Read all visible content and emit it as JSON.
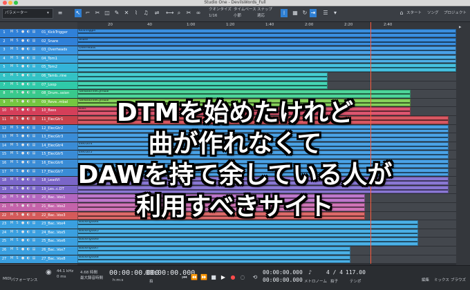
{
  "window": {
    "title": "Studio One - DevilsWords_Full"
  },
  "toolbar": {
    "param_label": "パラメーター",
    "quantize_label": "クオンタイズ",
    "quantize_value": "1/16",
    "timebase_label": "タイムベース",
    "timebase_value": "小節",
    "snap_label": "スナップ",
    "snap_value": "適応",
    "start_label": "スタート",
    "song_label": "ソング",
    "project_label": "プロジェクト"
  },
  "ruler": {
    "ticks": [
      "20",
      "40",
      "1:00",
      "1:20",
      "1:40",
      "2:00",
      "2:20",
      "2:40"
    ]
  },
  "tracks": [
    {
      "num": "1",
      "name": "01_KickTrigger",
      "color": "#2f80d8"
    },
    {
      "num": "2",
      "name": "02_Snare",
      "color": "#2f80d8"
    },
    {
      "num": "3",
      "name": "03_Overheads",
      "color": "#3a94e0"
    },
    {
      "num": "4",
      "name": "04_Tom1",
      "color": "#3aa5df"
    },
    {
      "num": "5",
      "name": "05_Tom2",
      "color": "#34b4d8"
    },
    {
      "num": "6",
      "name": "06_Tamb..rine",
      "color": "#33c2c4"
    },
    {
      "num": "7",
      "name": "07_Loop",
      "color": "#2fcaa9"
    },
    {
      "num": "8",
      "name": "08_Drum..ssion",
      "color": "#39c98c"
    },
    {
      "num": "9",
      "name": "09_Reve..mbal",
      "color": "#74c640"
    },
    {
      "num": "10",
      "name": "10_Bass",
      "color": "#d43f59"
    },
    {
      "num": "11",
      "name": "11_ElecGtr1",
      "color": "#c8414a"
    },
    {
      "num": "12",
      "name": "12_ElecGtr2",
      "color": "#3a8cd6"
    },
    {
      "num": "13",
      "name": "13_ElecGtr3",
      "color": "#3a8cd6"
    },
    {
      "num": "14",
      "name": "14_ElecGtr4",
      "color": "#3a8cd6"
    },
    {
      "num": "15",
      "name": "15_ElecGtr5",
      "color": "#3a8cd6"
    },
    {
      "num": "16",
      "name": "16_ElecGtr6",
      "color": "#3a8cd6"
    },
    {
      "num": "17",
      "name": "17_ElecGtr7",
      "color": "#3a8cd6"
    },
    {
      "num": "18",
      "name": "18_LeadVl",
      "color": "#7a66c8"
    },
    {
      "num": "19",
      "name": "19_Les..c.DT",
      "color": "#7a66c8"
    },
    {
      "num": "20",
      "name": "20_Bac..Vox1",
      "color": "#b266c0"
    },
    {
      "num": "21",
      "name": "21_Bac..Vox2",
      "color": "#c463aa"
    },
    {
      "num": "22",
      "name": "22_Bac..Vox3",
      "color": "#d45a5a"
    },
    {
      "num": "23",
      "name": "23_Bac..Vox4",
      "color": "#3a9fe0"
    },
    {
      "num": "24",
      "name": "24_Bac..Vox5",
      "color": "#3a9fe0"
    },
    {
      "num": "25",
      "name": "25_Bac..Vox6",
      "color": "#3a9fe0"
    },
    {
      "num": "26",
      "name": "26_Bac..Vox7",
      "color": "#3a9fe0"
    },
    {
      "num": "27",
      "name": "27_Bac..Vox8",
      "color": "#3a9fe0"
    }
  ],
  "clips": [
    {
      "lane": 0,
      "label": "KickTrigger",
      "color": "#3a8fe0",
      "start": 0.0,
      "end": 1.0
    },
    {
      "lane": 1,
      "label": "Snare",
      "color": "#3a8fe0",
      "start": 0.0,
      "end": 1.0
    },
    {
      "lane": 2,
      "label": "Overheads",
      "color": "#4aa0e6",
      "start": 0.0,
      "end": 1.0
    },
    {
      "lane": 3,
      "label": "",
      "color": "#4fb0e6",
      "start": 0.0,
      "end": 1.0
    },
    {
      "lane": 4,
      "label": "",
      "color": "#46c0df",
      "start": 0.0,
      "end": 1.0
    },
    {
      "lane": 5,
      "label": "",
      "color": "#46cdd0",
      "start": 0.0,
      "end": 0.66
    },
    {
      "lane": 6,
      "label": "",
      "color": "#46d6b5",
      "start": 0.0,
      "end": 0.66
    },
    {
      "lane": 7,
      "label": "TambourineCymbal",
      "color": "#4ed59a",
      "start": 0.0,
      "end": 0.88
    },
    {
      "lane": 8,
      "label": "TambourineCymbal",
      "color": "#86d25a",
      "start": 0.0,
      "end": 0.88
    },
    {
      "lane": 9,
      "label": "Bass",
      "color": "#de5670",
      "start": 0.0,
      "end": 0.88
    },
    {
      "lane": 10,
      "label": "",
      "color": "#d85862",
      "start": 0.0,
      "end": 0.98
    },
    {
      "lane": 11,
      "label": "",
      "color": "#4aa2e6",
      "start": 0.0,
      "end": 0.98
    },
    {
      "lane": 12,
      "label": "",
      "color": "#4aa2e6",
      "start": 0.0,
      "end": 0.98
    },
    {
      "lane": 13,
      "label": "ElecGtr4",
      "color": "#4aa2e6",
      "start": 0.0,
      "end": 0.98
    },
    {
      "lane": 14,
      "label": "ElecGtr5",
      "color": "#4aa2e6",
      "start": 0.0,
      "end": 0.98
    },
    {
      "lane": 15,
      "label": "",
      "color": "#4aa2e6",
      "start": 0.0,
      "end": 0.98
    },
    {
      "lane": 16,
      "label": "",
      "color": "#4aa2e6",
      "start": 0.0,
      "end": 0.98
    },
    {
      "lane": 17,
      "label": "",
      "color": "#8a78d4",
      "start": 0.0,
      "end": 0.98
    },
    {
      "lane": 18,
      "label": "",
      "color": "#8a78d4",
      "start": 0.0,
      "end": 0.98
    },
    {
      "lane": 19,
      "label": "",
      "color": "#bf78cc",
      "start": 0.0,
      "end": 0.76
    },
    {
      "lane": 20,
      "label": "",
      "color": "#cf74b6",
      "start": 0.0,
      "end": 0.76
    },
    {
      "lane": 21,
      "label": "",
      "color": "#de6a6a",
      "start": 0.0,
      "end": 0.76
    },
    {
      "lane": 22,
      "label": "BackingVox4",
      "color": "#4ab0e6",
      "start": 0.0,
      "end": 0.9
    },
    {
      "lane": 23,
      "label": "BackingVox5",
      "color": "#4ab0e6",
      "start": 0.0,
      "end": 0.9
    },
    {
      "lane": 24,
      "label": "BackingVox6",
      "color": "#4ab0e6",
      "start": 0.0,
      "end": 0.9
    },
    {
      "lane": 25,
      "label": "BackingVox7",
      "color": "#4ab0e6",
      "start": 0.0,
      "end": 0.72
    },
    {
      "lane": 26,
      "label": "BackingVox8",
      "color": "#4ab0e6",
      "start": 0.0,
      "end": 0.72
    }
  ],
  "rightpanel": {
    "edit_label": "編集",
    "mix_label": "ミックス",
    "browse_label": "ブラウズ"
  },
  "transport": {
    "samplerate": "44.1 kHz",
    "latency": "0 ms",
    "disk": "4.68 時間",
    "disk_label": "最大録音時間",
    "midi_label": "MIDI",
    "perf_label": "パフォーマンス",
    "time_main": "00:00:00.000",
    "time_sub": "00:00:00.000",
    "loop_start": "00:00:00.000",
    "loop_end": "00:00:00.000",
    "signature": "4 / 4",
    "tempo": "117.00",
    "metronome_label": "メトロノーム",
    "sig_label": "拍子",
    "tempo_label": "テンポ",
    "beat_label": "拍"
  },
  "overlay": {
    "line1": "DTMを始めたけれど",
    "line2": "曲が作れなくて",
    "line3": "DAWを持て余している人が",
    "line4": "利用すべきサイト"
  },
  "colors": {
    "accent": "#2f7fd2",
    "playhead": "#ff5a3c"
  }
}
